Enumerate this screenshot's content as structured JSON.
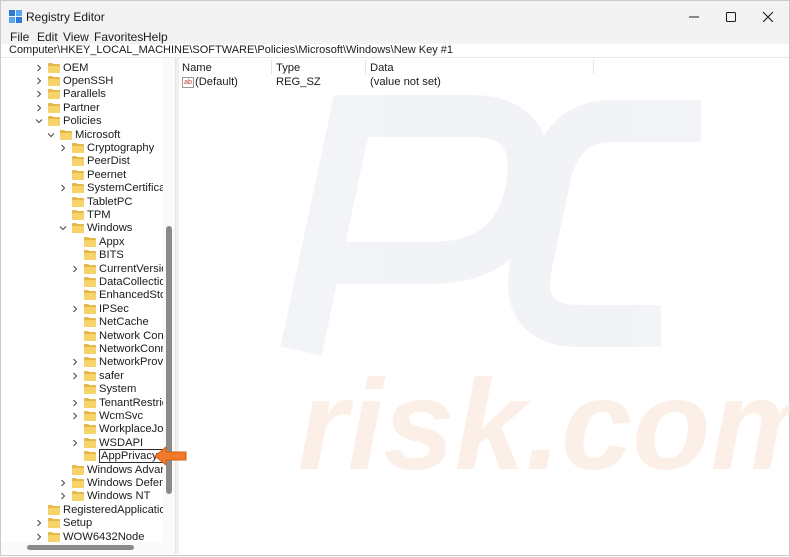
{
  "window": {
    "title": "Registry Editor",
    "icon": "registry-icon",
    "controls": [
      "minimize-icon",
      "maximize-icon",
      "close-icon"
    ]
  },
  "menu": [
    "File",
    "Edit",
    "View",
    "Favorites",
    "Help"
  ],
  "address": "Computer\\HKEY_LOCAL_MACHINE\\SOFTWARE\\Policies\\Microsoft\\Windows\\New Key #1",
  "tree": [
    {
      "label": "OEM",
      "expander": "collapsed"
    },
    {
      "label": "OpenSSH",
      "expander": "collapsed"
    },
    {
      "label": "Parallels",
      "expander": "collapsed"
    },
    {
      "label": "Partner",
      "expander": "collapsed"
    },
    {
      "label": "Policies",
      "expander": "expanded"
    },
    {
      "label": "Microsoft",
      "expander": "expanded"
    },
    {
      "label": "Cryptography",
      "expander": "collapsed"
    },
    {
      "label": "PeerDist",
      "expander": "none"
    },
    {
      "label": "Peernet",
      "expander": "none"
    },
    {
      "label": "SystemCertificates",
      "expander": "collapsed"
    },
    {
      "label": "TabletPC",
      "expander": "none"
    },
    {
      "label": "TPM",
      "expander": "none"
    },
    {
      "label": "Windows",
      "expander": "expanded"
    },
    {
      "label": "Appx",
      "expander": "none"
    },
    {
      "label": "BITS",
      "expander": "none"
    },
    {
      "label": "CurrentVersion",
      "expander": "collapsed"
    },
    {
      "label": "DataCollection",
      "expander": "none"
    },
    {
      "label": "EnhancedStorag",
      "expander": "none"
    },
    {
      "label": "IPSec",
      "expander": "collapsed"
    },
    {
      "label": "NetCache",
      "expander": "none"
    },
    {
      "label": "Network Conne",
      "expander": "none"
    },
    {
      "label": "NetworkConnec",
      "expander": "none"
    },
    {
      "label": "NetworkProvide",
      "expander": "collapsed"
    },
    {
      "label": "safer",
      "expander": "collapsed"
    },
    {
      "label": "System",
      "expander": "none"
    },
    {
      "label": "TenantRestrictic",
      "expander": "collapsed"
    },
    {
      "label": "WcmSvc",
      "expander": "collapsed"
    },
    {
      "label": "WorkplaceJoin",
      "expander": "none"
    },
    {
      "label": "WSDAPI",
      "expander": "collapsed"
    },
    {
      "label": "AppPrivacy",
      "expander": "none",
      "editing": true
    },
    {
      "label": "Windows Advance",
      "expander": "none"
    },
    {
      "label": "Windows Defende",
      "expander": "collapsed"
    },
    {
      "label": "Windows NT",
      "expander": "collapsed"
    },
    {
      "label": "RegisteredApplications",
      "expander": "none"
    },
    {
      "label": "Setup",
      "expander": "collapsed"
    },
    {
      "label": "WOW6432Node",
      "expander": "collapsed"
    }
  ],
  "values_table": {
    "headers": [
      "Name",
      "Type",
      "Data"
    ],
    "rows": [
      {
        "name": "(Default)",
        "type": "REG_SZ",
        "data": "(value not set)",
        "icon": "string-value-icon"
      }
    ]
  },
  "watermark": {
    "line1": "PC",
    "line2": "risk.com"
  },
  "colors": {
    "arrow": "#f07a26",
    "folder": "#f7d36c",
    "titlebar": "#f3f3f3"
  }
}
